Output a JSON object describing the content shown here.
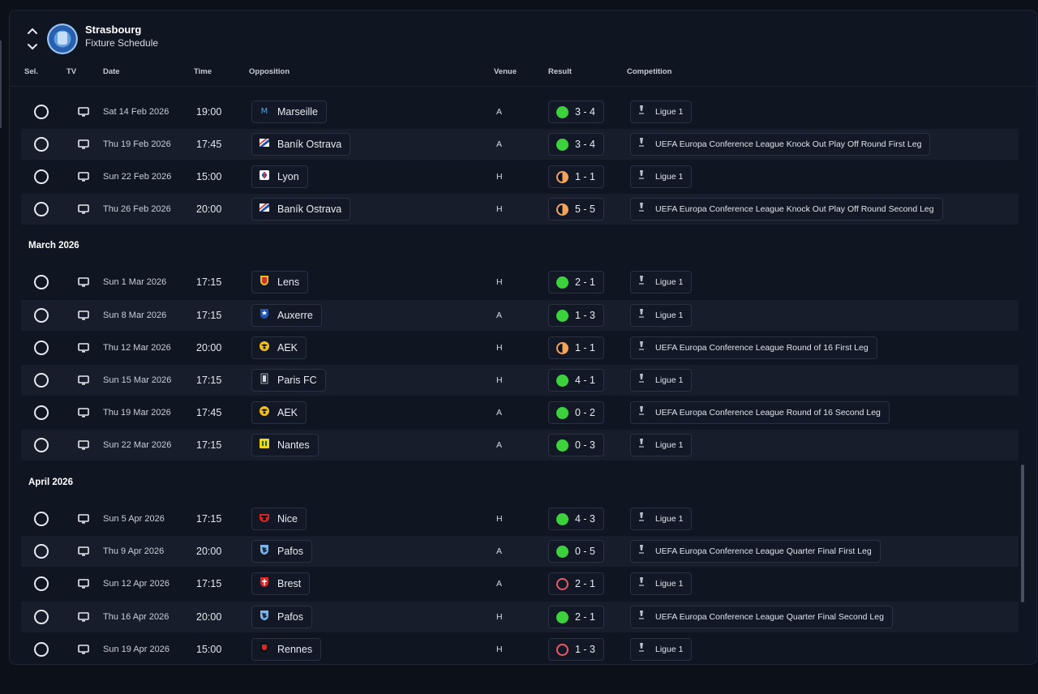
{
  "header": {
    "team_name": "Strasbourg",
    "subtitle": "Fixture Schedule"
  },
  "columns": {
    "sel": "Sel.",
    "tv": "TV",
    "date": "Date",
    "time": "Time",
    "opposition": "Opposition",
    "venue": "Venue",
    "result": "Result",
    "competition": "Competition"
  },
  "months": {
    "march": "March 2026",
    "april": "April 2026"
  },
  "colors": {
    "win": "#3ed13e",
    "draw": "#f0a55a",
    "loss": "#e85b66",
    "background": "#101522",
    "row_alt": "#171d2a"
  },
  "fixtures": [
    {
      "date": "Sat 14 Feb 2026",
      "time": "19:00",
      "opposition": "Marseille",
      "venue": "A",
      "outcome": "win",
      "score": "3 - 4",
      "competition": "Ligue 1"
    },
    {
      "date": "Thu 19 Feb 2026",
      "time": "17:45",
      "opposition": "Baník Ostrava",
      "venue": "A",
      "outcome": "win",
      "score": "3 - 4",
      "competition": "UEFA Europa Conference League Knock Out Play Off Round First Leg"
    },
    {
      "date": "Sun 22 Feb 2026",
      "time": "15:00",
      "opposition": "Lyon",
      "venue": "H",
      "outcome": "draw",
      "score": "1 - 1",
      "competition": "Ligue 1"
    },
    {
      "date": "Thu 26 Feb 2026",
      "time": "20:00",
      "opposition": "Baník Ostrava",
      "venue": "H",
      "outcome": "draw",
      "score": "5 - 5",
      "competition": "UEFA Europa Conference League Knock Out Play Off Round Second Leg"
    },
    {
      "date": "Sun 1 Mar 2026",
      "time": "17:15",
      "opposition": "Lens",
      "venue": "H",
      "outcome": "win",
      "score": "2 - 1",
      "competition": "Ligue 1"
    },
    {
      "date": "Sun 8 Mar 2026",
      "time": "17:15",
      "opposition": "Auxerre",
      "venue": "A",
      "outcome": "win",
      "score": "1 - 3",
      "competition": "Ligue 1"
    },
    {
      "date": "Thu 12 Mar 2026",
      "time": "20:00",
      "opposition": "AEK",
      "venue": "H",
      "outcome": "draw",
      "score": "1 - 1",
      "competition": "UEFA Europa Conference League Round of 16  First Leg"
    },
    {
      "date": "Sun 15 Mar 2026",
      "time": "17:15",
      "opposition": "Paris FC",
      "venue": "H",
      "outcome": "win",
      "score": "4 - 1",
      "competition": "Ligue 1"
    },
    {
      "date": "Thu 19 Mar 2026",
      "time": "17:45",
      "opposition": "AEK",
      "venue": "A",
      "outcome": "win",
      "score": "0 - 2",
      "competition": "UEFA Europa Conference League Round of 16  Second Leg"
    },
    {
      "date": "Sun 22 Mar 2026",
      "time": "17:15",
      "opposition": "Nantes",
      "venue": "A",
      "outcome": "win",
      "score": "0 - 3",
      "competition": "Ligue 1"
    },
    {
      "date": "Sun 5 Apr 2026",
      "time": "17:15",
      "opposition": "Nice",
      "venue": "H",
      "outcome": "win",
      "score": "4 - 3",
      "competition": "Ligue 1"
    },
    {
      "date": "Thu 9 Apr 2026",
      "time": "20:00",
      "opposition": "Pafos",
      "venue": "A",
      "outcome": "win",
      "score": "0 - 5",
      "competition": "UEFA Europa Conference League Quarter Final First Leg"
    },
    {
      "date": "Sun 12 Apr 2026",
      "time": "17:15",
      "opposition": "Brest",
      "venue": "A",
      "outcome": "loss",
      "score": "2 - 1",
      "competition": "Ligue 1"
    },
    {
      "date": "Thu 16 Apr 2026",
      "time": "20:00",
      "opposition": "Pafos",
      "venue": "H",
      "outcome": "win",
      "score": "2 - 1",
      "competition": "UEFA Europa Conference League Quarter Final Second Leg"
    },
    {
      "date": "Sun 19 Apr 2026",
      "time": "15:00",
      "opposition": "Rennes",
      "venue": "H",
      "outcome": "loss",
      "score": "1 - 3",
      "competition": "Ligue 1"
    }
  ]
}
